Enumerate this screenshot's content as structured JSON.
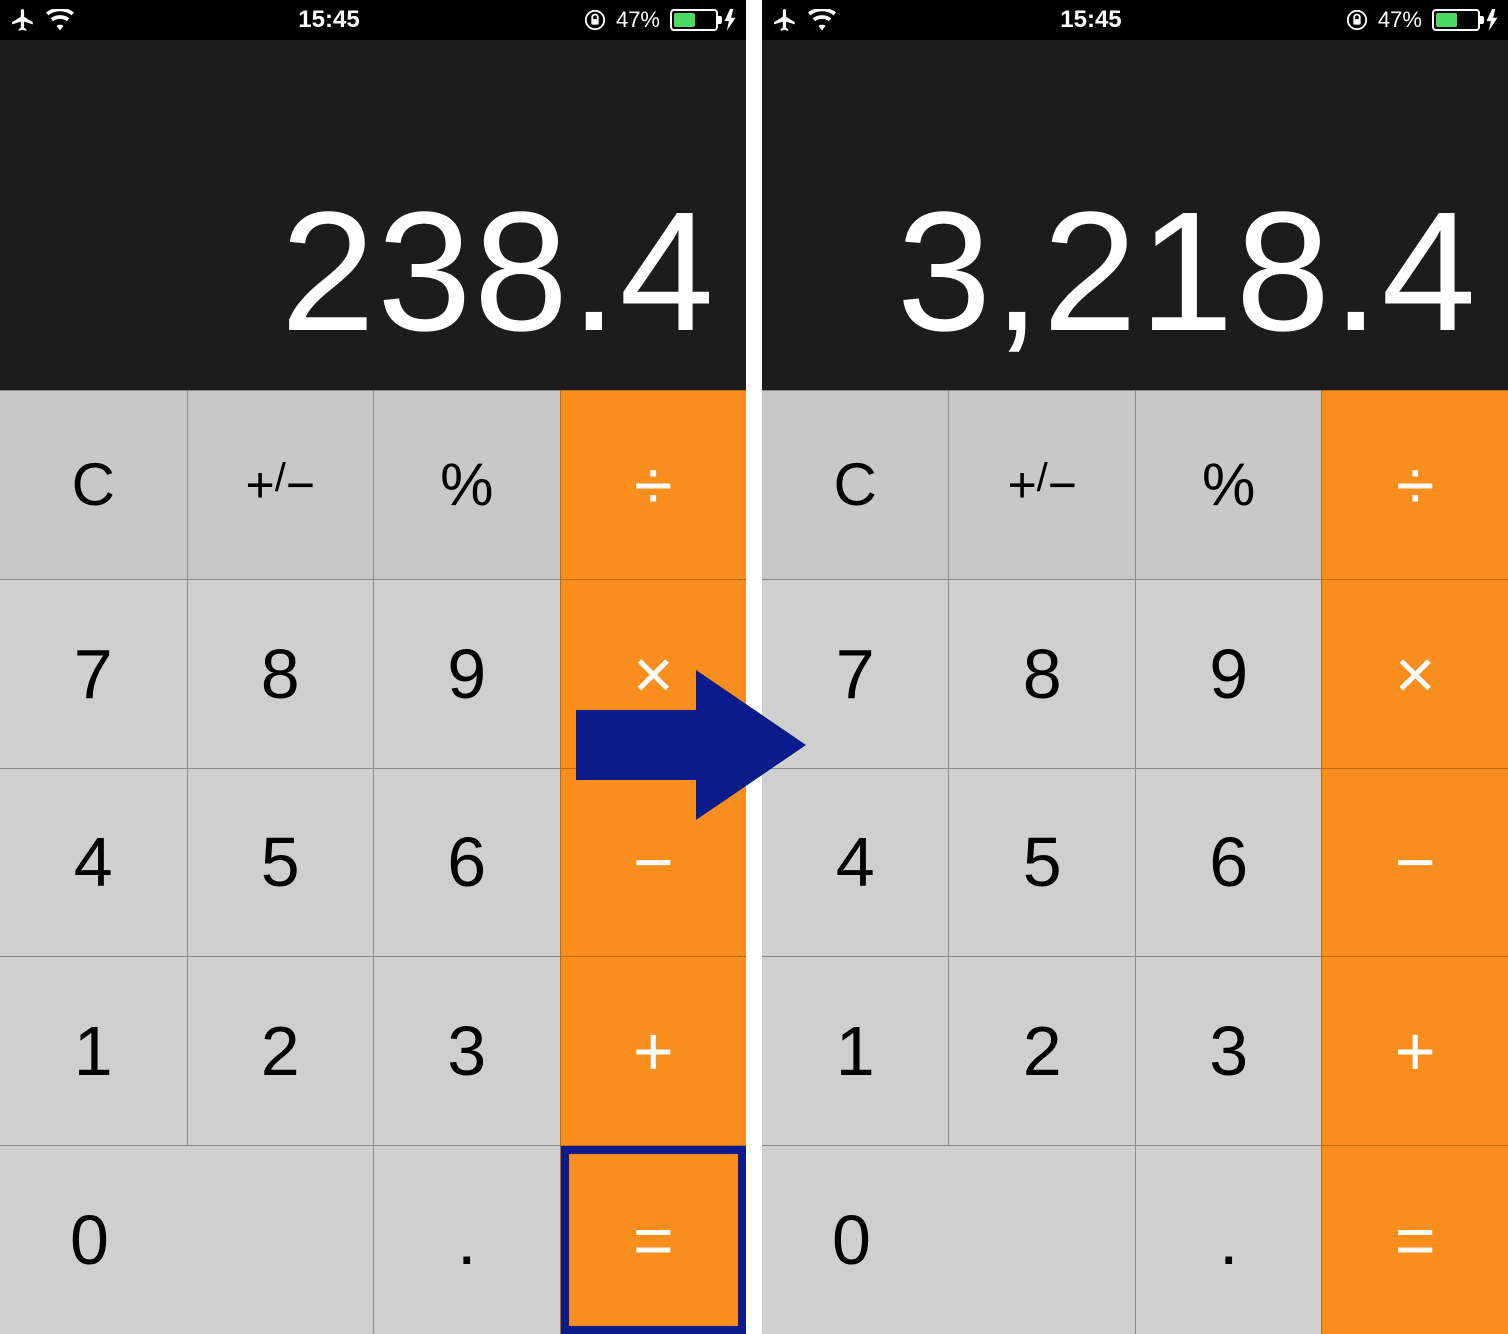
{
  "status": {
    "time": "15:45",
    "battery_pct": "47%",
    "battery_fill_pct": 47
  },
  "screens": [
    {
      "display": "238.4",
      "highlight_equals": true
    },
    {
      "display": "3,218.4",
      "highlight_equals": false
    }
  ],
  "keys": {
    "clear": "C",
    "plusminus": "+/−",
    "percent": "%",
    "divide": "÷",
    "seven": "7",
    "eight": "8",
    "nine": "9",
    "multiply": "×",
    "four": "4",
    "five": "5",
    "six": "6",
    "minus": "−",
    "one": "1",
    "two": "2",
    "three": "3",
    "plus": "+",
    "zero": "0",
    "decimal": ".",
    "equals": "="
  },
  "annotation": {
    "arrow_color": "#0b1b8b",
    "highlight_color": "#0b1b8b"
  }
}
